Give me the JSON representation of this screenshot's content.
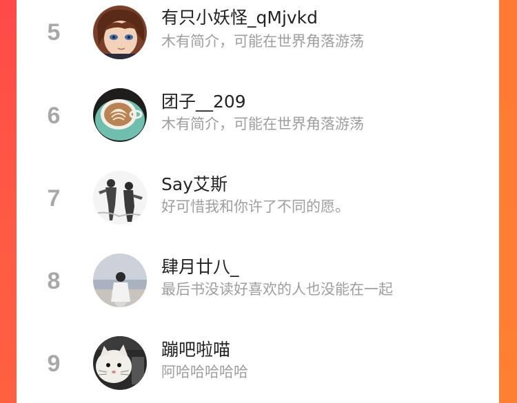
{
  "ranking": {
    "items": [
      {
        "rank": "5",
        "name": "有只小妖怪_qMjvkd",
        "bio": "木有简介，可能在世界角落游荡",
        "avatar": "anime-boy-avatar"
      },
      {
        "rank": "6",
        "name": "团子__209",
        "bio": "木有简介，可能在世界角落游荡",
        "avatar": "coffee-cup-avatar"
      },
      {
        "rank": "7",
        "name": "Say艾斯",
        "bio": "好可惜我和你许了不同的愿。",
        "avatar": "sketch-couple-avatar"
      },
      {
        "rank": "8",
        "name": "肆月廿八_",
        "bio": "最后书没读好喜欢的人也没能在一起",
        "avatar": "seaside-person-avatar"
      },
      {
        "rank": "9",
        "name": "蹦吧啦喵",
        "bio": "阿哈哈哈哈哈",
        "avatar": "cat-avatar"
      }
    ]
  }
}
